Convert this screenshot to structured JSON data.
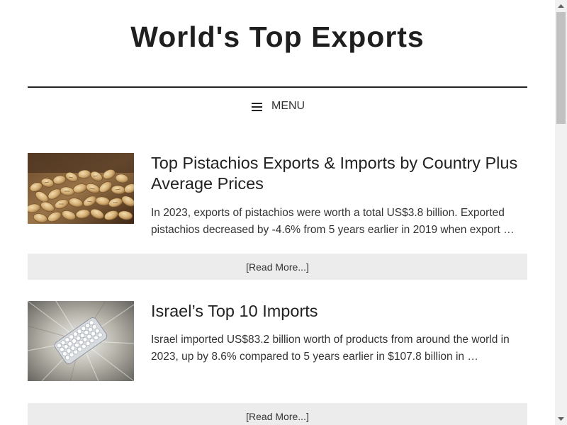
{
  "site": {
    "title": "World's Top Exports"
  },
  "nav": {
    "menu_label": "MENU",
    "menu_icon": "hamburger-icon"
  },
  "articles": [
    {
      "title": "Top Pistachios Exports & Imports by Country Plus Average Prices",
      "excerpt": "In 2023, exports of pistachios were worth a total US$3.8 billion. Exported pistachios decreased by -4.6% from 5 years earlier in 2019 when export …",
      "read_more": "[Read More...]",
      "thumbnail": "pistachios-image"
    },
    {
      "title": "Israel’s Top 10 Imports",
      "excerpt": "Israel imported US$83.2 billion worth of products from around the world in 2023, up by 8.6% compared to 5 years earlier in $107.8 billion in …",
      "read_more": "[Read More...]",
      "thumbnail": "diamond-bracelet-image"
    }
  ],
  "colors": {
    "read_more_bg": "#ececec",
    "divider": "#222222",
    "text": "#222222"
  }
}
